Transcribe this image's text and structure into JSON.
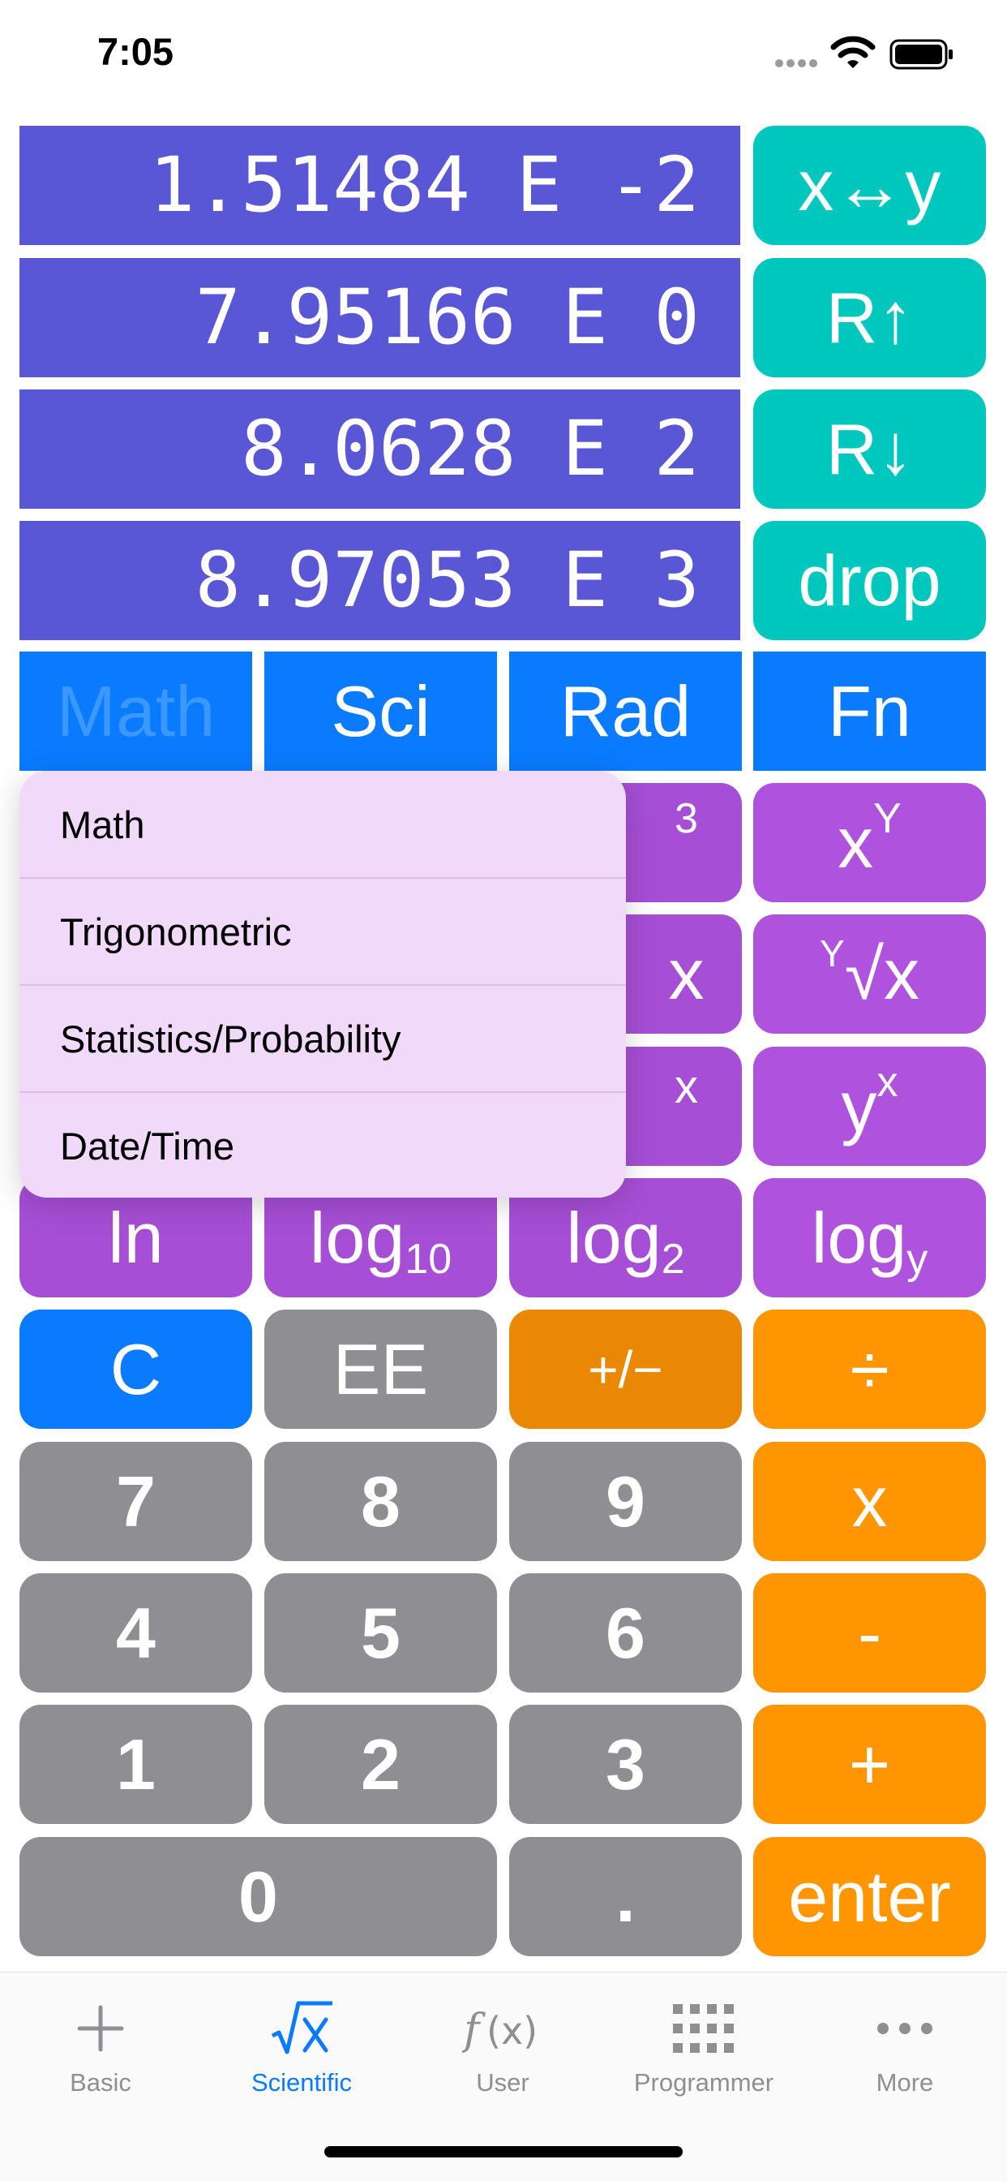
{
  "status": {
    "time": "7:05"
  },
  "stack": [
    "1.51484 E -2",
    "7.95166 E 0",
    "8.0628 E 2",
    "8.97053 E 3"
  ],
  "stack_buttons": [
    "x↔y",
    "R↑",
    "R↓",
    "drop"
  ],
  "modes": {
    "math": "Math",
    "sci": "Sci",
    "rad": "Rad",
    "fn": "Fn"
  },
  "menu": {
    "items": [
      "Math",
      "Trigonometric",
      "Statistics/Probability",
      "Date/Time"
    ]
  },
  "keys": {
    "x_cubed_sup": "3",
    "x_pow_y": {
      "base": "x",
      "exp": "Y"
    },
    "root_x_partial": "x",
    "y_root_x": {
      "index": "Y",
      "radical": "√",
      "x": "x"
    },
    "e_pow_x_partial": "x",
    "y_pow_x": {
      "base": "y",
      "exp": "x"
    },
    "ln": "ln",
    "log10": {
      "base": "log",
      "sub": "10"
    },
    "log2": {
      "base": "log",
      "sub": "2"
    },
    "logy": {
      "base": "log",
      "sub": "y"
    },
    "clear": "C",
    "ee": "EE",
    "plus_minus": "+/−",
    "divide": "÷",
    "seven": "7",
    "eight": "8",
    "nine": "9",
    "multiply": "x",
    "four": "4",
    "five": "5",
    "six": "6",
    "minus": "-",
    "one": "1",
    "two": "2",
    "three": "3",
    "plus": "+",
    "zero": "0",
    "dot": ".",
    "enter": "enter"
  },
  "tabs": [
    {
      "label": "Basic",
      "icon": "plus-icon"
    },
    {
      "label": "Scientific",
      "icon": "sqrt-icon"
    },
    {
      "label": "User",
      "icon": "function-icon"
    },
    {
      "label": "Programmer",
      "icon": "grid-icon"
    },
    {
      "label": "More",
      "icon": "ellipsis-icon"
    }
  ],
  "colors": {
    "stack_bg": "#5a57d6",
    "teal": "#00c7be",
    "blue": "#0a7bff",
    "purple": "#af52de",
    "gray": "#8e8e93",
    "orange": "#ff9500",
    "menu_bg": "#f1d9fa"
  }
}
